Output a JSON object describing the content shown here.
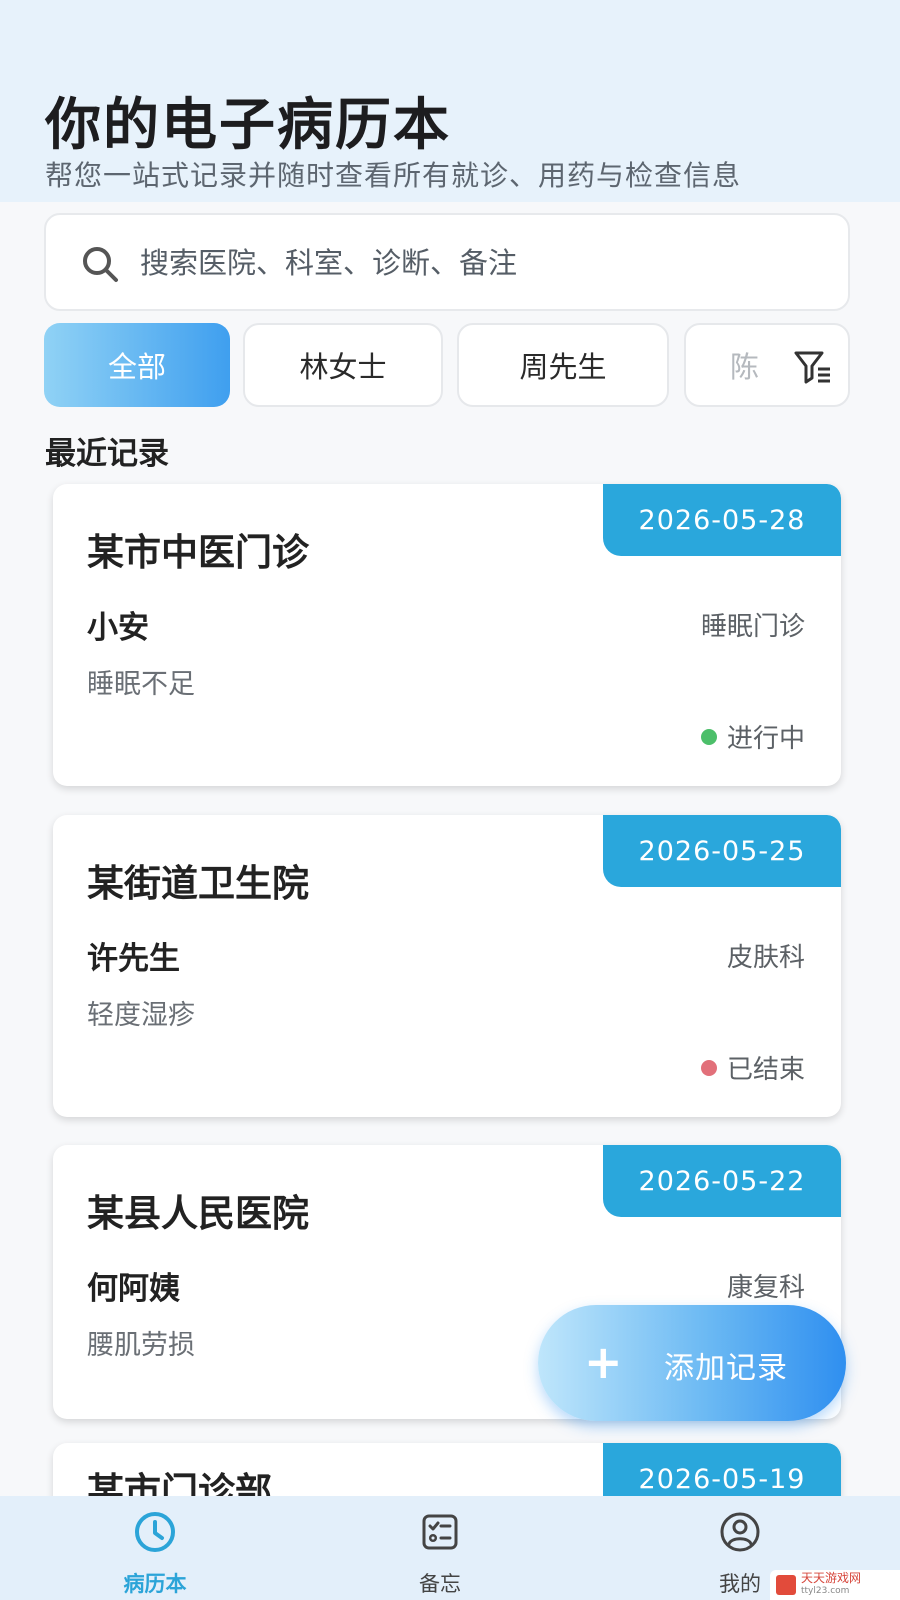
{
  "header": {
    "title": "你的电子病历本",
    "subtitle": "帮您一站式记录并随时查看所有就诊、用药与检查信息"
  },
  "search": {
    "placeholder": "搜索医院、科室、诊断、备注",
    "icon": "search-icon"
  },
  "filters": [
    {
      "label": "全部",
      "active": true
    },
    {
      "label": "林女士",
      "active": false
    },
    {
      "label": "周先生",
      "active": false
    },
    {
      "label": "陈",
      "active": false
    }
  ],
  "filter_icon": "filter-icon",
  "section_title": "最近记录",
  "records": [
    {
      "date": "2026-05-28",
      "hospital": "某市中医门诊",
      "patient": "小安",
      "department": "睡眠门诊",
      "diagnosis": "睡眠不足",
      "status": "进行中",
      "status_color": "#4cbf6a"
    },
    {
      "date": "2026-05-25",
      "hospital": "某街道卫生院",
      "patient": "许先生",
      "department": "皮肤科",
      "diagnosis": "轻度湿疹",
      "status": "已结束",
      "status_color": "#e2707a"
    },
    {
      "date": "2026-05-22",
      "hospital": "某县人民医院",
      "patient": "何阿姨",
      "department": "康复科",
      "diagnosis": "腰肌劳损"
    },
    {
      "date": "2026-05-19",
      "hospital": "某市门诊部"
    }
  ],
  "fab": {
    "icon": "+",
    "label": "添加记录"
  },
  "bottom_nav": [
    {
      "label": "病历本",
      "icon": "clock-icon",
      "active": true
    },
    {
      "label": "备忘",
      "icon": "checklist-icon",
      "active": false
    },
    {
      "label": "我的",
      "icon": "user-icon",
      "active": false
    }
  ],
  "watermark": {
    "line1": "天天游戏网",
    "line2": "ttyl23.com"
  },
  "colors": {
    "accent": "#2aa7dc",
    "header_bg": "#e7f2fb",
    "nav_bg": "#e3effa"
  }
}
